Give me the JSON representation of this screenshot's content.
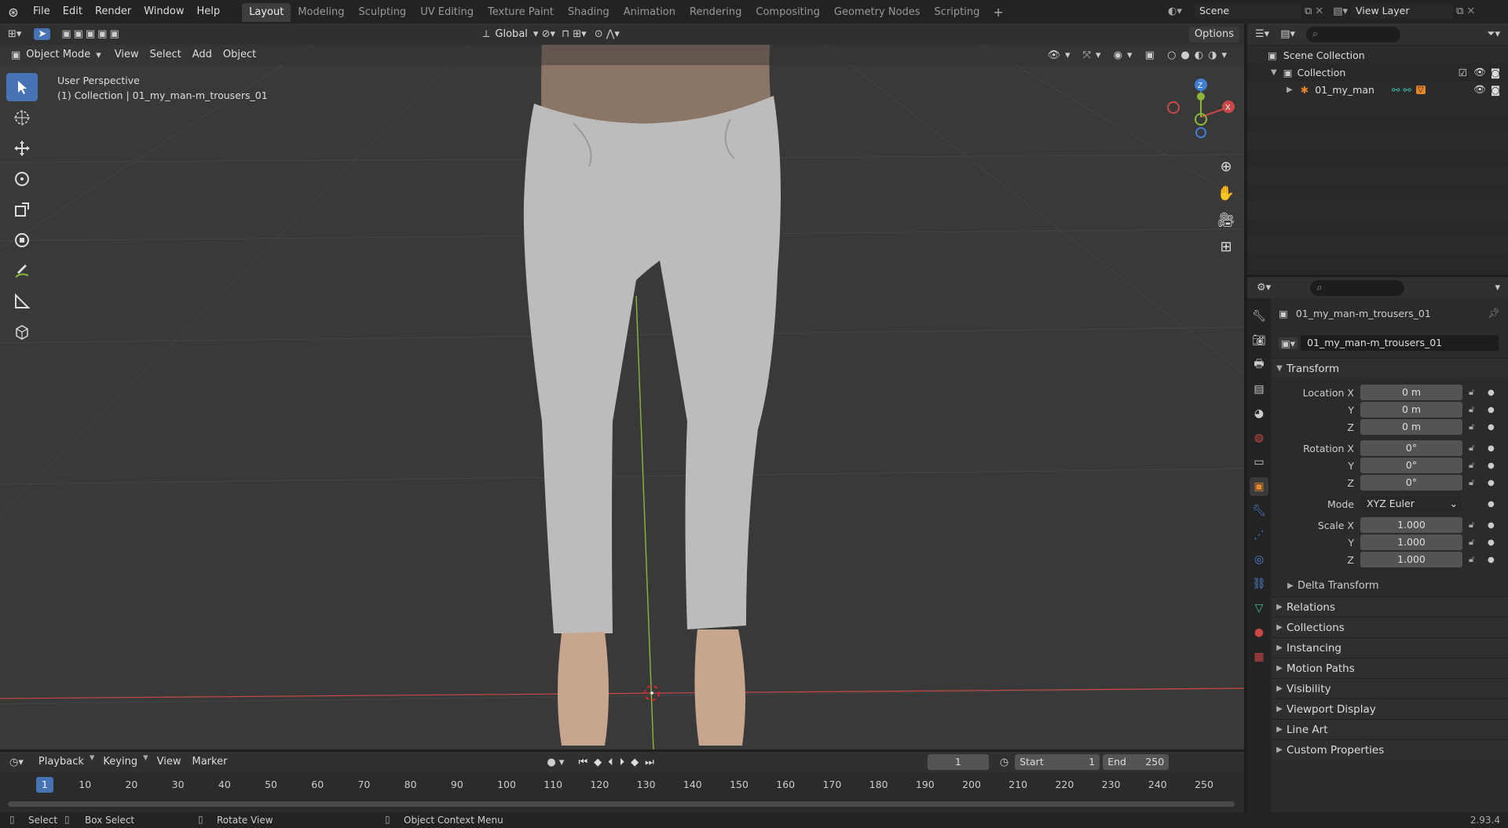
{
  "app": {
    "version": "2.93.4"
  },
  "menu": [
    "File",
    "Edit",
    "Render",
    "Window",
    "Help"
  ],
  "workspaces": [
    "Layout",
    "Modeling",
    "Sculpting",
    "UV Editing",
    "Texture Paint",
    "Shading",
    "Animation",
    "Rendering",
    "Compositing",
    "Geometry Nodes",
    "Scripting"
  ],
  "active_workspace": "Layout",
  "scene": {
    "name": "Scene",
    "view_layer": "View Layer"
  },
  "viewport": {
    "mode": "Object Mode",
    "menus": [
      "View",
      "Select",
      "Add",
      "Object"
    ],
    "orientation": "Global",
    "options_label": "Options",
    "perspective": "User Perspective",
    "collection_info": "(1) Collection | 01_my_man-m_trousers_01"
  },
  "outliner": {
    "scene_collection": "Scene Collection",
    "collection": "Collection",
    "object": "01_my_man"
  },
  "properties": {
    "object_name": "01_my_man-m_trousers_01",
    "transform_title": "Transform",
    "location": {
      "label": "Location X",
      "x": "0 m",
      "y": "0 m",
      "z": "0 m"
    },
    "rotation": {
      "label": "Rotation X",
      "x": "0°",
      "y": "0°",
      "z": "0°"
    },
    "mode_label": "Mode",
    "mode_value": "XYZ Euler",
    "scale": {
      "label": "Scale X",
      "x": "1.000",
      "y": "1.000",
      "z": "1.000"
    },
    "axis_y": "Y",
    "axis_z": "Z",
    "delta_transform": "Delta Transform",
    "panels": [
      "Relations",
      "Collections",
      "Instancing",
      "Motion Paths",
      "Visibility",
      "Viewport Display",
      "Line Art",
      "Custom Properties"
    ]
  },
  "timeline": {
    "menus": [
      "Playback",
      "Keying",
      "View",
      "Marker"
    ],
    "current_frame": "1",
    "start_label": "Start",
    "start": "1",
    "end_label": "End",
    "end": "250",
    "ticks": [
      "1",
      "10",
      "20",
      "30",
      "40",
      "50",
      "60",
      "70",
      "80",
      "90",
      "100",
      "110",
      "120",
      "130",
      "140",
      "150",
      "160",
      "170",
      "180",
      "190",
      "200",
      "210",
      "220",
      "230",
      "240",
      "250"
    ]
  },
  "status": {
    "select": "Select",
    "box_select": "Box Select",
    "rotate_view": "Rotate View",
    "context_menu": "Object Context Menu"
  },
  "colors": {
    "accent": "#4772b3",
    "active_obj": "#e8852a",
    "x_axis": "#c94747",
    "y_axis": "#8bb738",
    "z_axis": "#3f7ed1"
  }
}
